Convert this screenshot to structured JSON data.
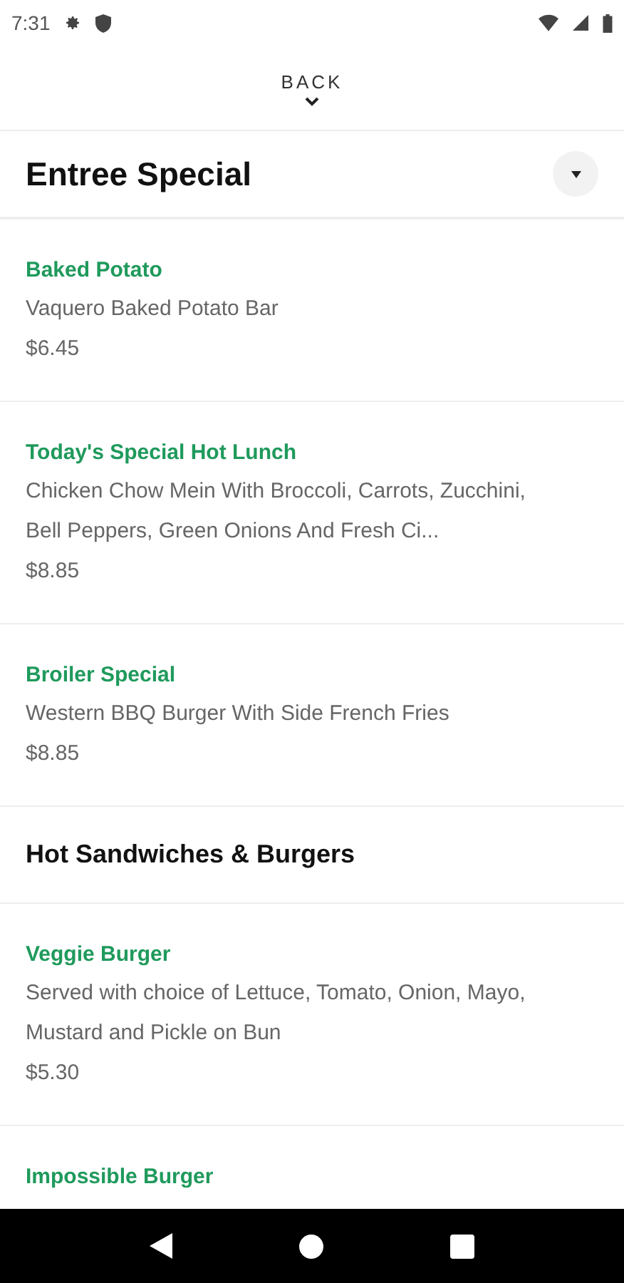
{
  "status_bar": {
    "time": "7:31"
  },
  "back": {
    "label": "BACK"
  },
  "header": {
    "title": "Entree Special"
  },
  "sections": [
    {
      "kind": "items",
      "items": [
        {
          "name": "Baked Potato",
          "description": "Vaquero Baked Potato Bar",
          "price": "$6.45"
        },
        {
          "name": "Today's Special Hot Lunch",
          "description": "Chicken Chow Mein With Broccoli, Carrots, Zucchini, Bell Peppers, Green Onions And Fresh Ci...",
          "price": "$8.85"
        },
        {
          "name": "Broiler Special",
          "description": "Western BBQ Burger With Side French Fries",
          "price": "$8.85"
        }
      ]
    },
    {
      "kind": "heading",
      "title": "Hot Sandwiches & Burgers"
    },
    {
      "kind": "items",
      "items": [
        {
          "name": "Veggie Burger",
          "description": "Served with choice of Lettuce, Tomato, Onion, Mayo, Mustard and Pickle on Bun",
          "price": "$5.30"
        },
        {
          "name": "Impossible Burger"
        }
      ]
    }
  ]
}
